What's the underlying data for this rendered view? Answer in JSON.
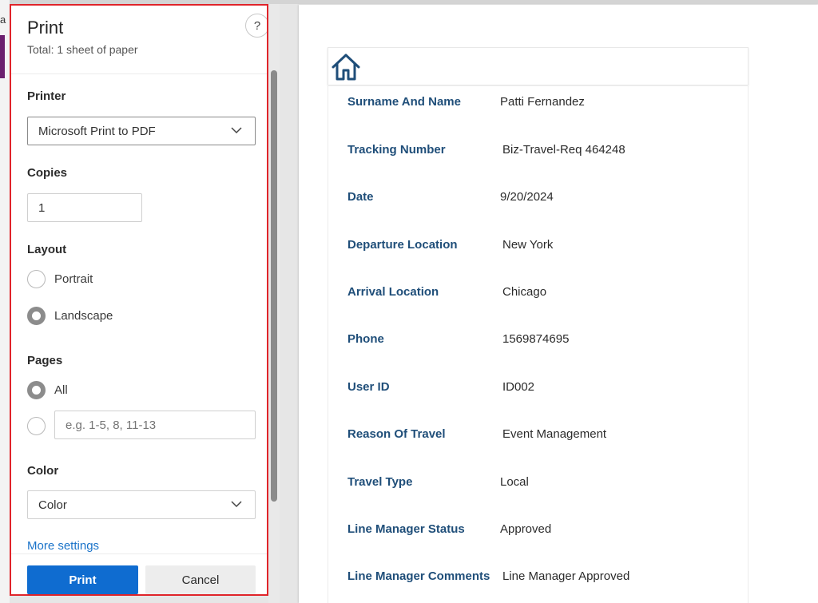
{
  "background_app": {
    "partial_text": "a"
  },
  "print_dialog": {
    "title": "Print",
    "subtitle": "Total: 1 sheet of paper",
    "help_label": "?",
    "printer": {
      "label": "Printer",
      "selected": "Microsoft Print to PDF"
    },
    "copies": {
      "label": "Copies",
      "value": "1"
    },
    "layout": {
      "label": "Layout",
      "options": [
        {
          "label": "Portrait",
          "checked": false
        },
        {
          "label": "Landscape",
          "checked": true
        }
      ]
    },
    "pages": {
      "label": "Pages",
      "all_label": "All",
      "all_checked": true,
      "custom_checked": false,
      "custom_placeholder": "e.g. 1-5, 8, 11-13",
      "custom_value": ""
    },
    "color": {
      "label": "Color",
      "selected": "Color"
    },
    "more_settings_label": "More settings",
    "print_button": "Print",
    "cancel_button": "Cancel",
    "highlight_color": "#e0242a",
    "accent_color": "#0f6cd0"
  },
  "preview": {
    "header_icon": "home-icon",
    "fields": [
      {
        "label": "Surname And Name",
        "value": "Patti Fernandez"
      },
      {
        "label": "Tracking Number",
        "value": "Biz-Travel-Req 464248"
      },
      {
        "label": "Date",
        "value": "9/20/2024"
      },
      {
        "label": "Departure Location",
        "value": "New York"
      },
      {
        "label": "Arrival Location",
        "value": "Chicago"
      },
      {
        "label": "Phone",
        "value": "1569874695"
      },
      {
        "label": "User ID",
        "value": "ID002"
      },
      {
        "label": "Reason Of Travel",
        "value": "Event Management"
      },
      {
        "label": "Travel Type",
        "value": "Local"
      },
      {
        "label": "Line Manager Status",
        "value": "Approved"
      },
      {
        "label": "Line Manager Comments",
        "value": "Line Manager Approved"
      }
    ],
    "label_color": "#1f4e79"
  }
}
